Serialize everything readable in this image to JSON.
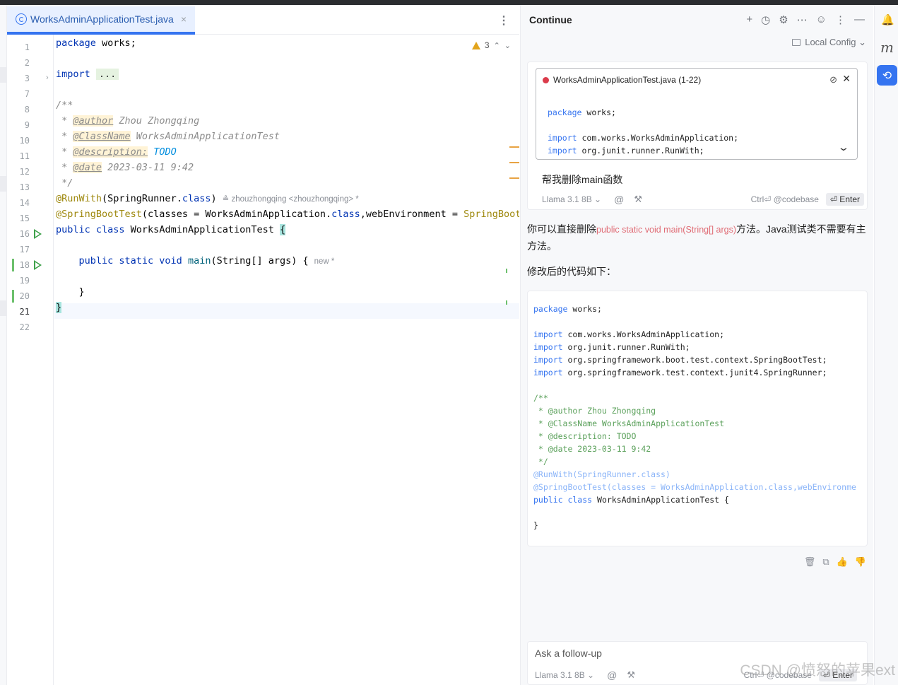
{
  "editor": {
    "tab": {
      "filename": "WorksAdminApplicationTest.java",
      "close": "×"
    },
    "tab_menu": "⋮",
    "warnings": {
      "count": "3",
      "up": "⌃",
      "down": "⌄"
    },
    "line_numbers": [
      "1",
      "2",
      "3",
      "7",
      "8",
      "9",
      "10",
      "11",
      "12",
      "13",
      "14",
      "15",
      "16",
      "17",
      "18",
      "19",
      "20",
      "21",
      "22"
    ],
    "lines": {
      "l1_kw": "package",
      "l1_rest": " works;",
      "l3_kw": "import",
      "l3_fold": "...",
      "l8": "/**",
      "l9_pre": " * ",
      "l9_tag": "@author",
      "l9_rest": " Zhou Zhongqing",
      "l10_pre": " * ",
      "l10_tag": "@ClassName",
      "l10_rest": " WorksAdminApplicationTest",
      "l11_pre": " * ",
      "l11_tag": "@description:",
      "l11_todo": " TODO",
      "l12_pre": " * ",
      "l12_tag": "@date",
      "l12_rest": " 2023-03-11 9:42",
      "l13": " */",
      "l14_ann": "@RunWith",
      "l14_a": "(SpringRunner.",
      "l14_kw": "class",
      "l14_b": ")",
      "l14_inlay": "≗ zhouzhongqing <zhouzhongqing> *",
      "l15_ann": "@SpringBootTest",
      "l15_a": "(classes = WorksAdminApplication.",
      "l15_kw": "class",
      "l15_b": ",webEnvironment = ",
      "l15_c": "SpringBootT",
      "l16_kw": "public class",
      "l16_rest": " WorksAdminApplicationTest ",
      "l16_brace": "{",
      "l18_kw": "    public static void",
      "l18_fn": " main",
      "l18_rest": "(String[] args) {",
      "l18_inlay": "new *",
      "l20": "    }",
      "l21": "}"
    }
  },
  "panel": {
    "title": "Continue",
    "tools": [
      "+",
      "◷",
      "⚙",
      "⋯",
      "☺",
      "⋮",
      "—"
    ],
    "config": "Local Config ⌄",
    "context": {
      "title": "WorksAdminApplicationTest.java (1-22)",
      "lines": [
        {
          "k": "package",
          "t": " works;"
        },
        {
          "k": "",
          "t": ""
        },
        {
          "k": "import",
          "t": " com.works.WorksAdminApplication;"
        },
        {
          "k": "import",
          "t": " org.junit.runner.RunWith;"
        }
      ]
    },
    "user_message": "帮我删除main函数",
    "input_footer": {
      "model": "Llama 3.1 8B ⌄",
      "at": "@",
      "tools": "⚒",
      "shortcut": "Ctrl⏎ @codebase",
      "enter": "⏎ Enter"
    },
    "answer": {
      "pre": "你可以直接删除",
      "code": "public static void main(String[] args)",
      "post": "方法。Java测试类不需要有主方法。"
    },
    "answer2": "修改后的代码如下：",
    "code_block": [
      {
        "k": "package",
        "t": " works;",
        "cls": ""
      },
      {
        "k": "",
        "t": "",
        "cls": ""
      },
      {
        "k": "import",
        "t": " com.works.WorksAdminApplication;",
        "cls": ""
      },
      {
        "k": "import",
        "t": " org.junit.runner.RunWith;",
        "cls": ""
      },
      {
        "k": "import",
        "t": " org.springframework.boot.test.context.SpringBootTest;",
        "cls": ""
      },
      {
        "k": "import",
        "t": " org.springframework.test.context.junit4.SpringRunner;",
        "cls": ""
      },
      {
        "k": "",
        "t": "",
        "cls": ""
      },
      {
        "k": "",
        "t": "/**",
        "cls": "c"
      },
      {
        "k": "",
        "t": " * @author Zhou Zhongqing",
        "cls": "c"
      },
      {
        "k": "",
        "t": " * @ClassName WorksAdminApplicationTest",
        "cls": "c"
      },
      {
        "k": "",
        "t": " * @description: TODO",
        "cls": "c"
      },
      {
        "k": "",
        "t": " * @date 2023-03-11 9:42",
        "cls": "c"
      },
      {
        "k": "",
        "t": " */",
        "cls": "c"
      },
      {
        "k": "",
        "t": "@RunWith(SpringRunner.class)",
        "cls": "a"
      },
      {
        "k": "",
        "t": "@SpringBootTest(classes = WorksAdminApplication.class,webEnvironme",
        "cls": "a"
      },
      {
        "k": "public class",
        "t": " WorksAdminApplicationTest {",
        "cls": ""
      },
      {
        "k": "",
        "t": "",
        "cls": ""
      },
      {
        "k": "",
        "t": "}",
        "cls": ""
      }
    ],
    "msg_actions": [
      "🗑",
      "⧉",
      "👍",
      "👎"
    ],
    "followup": {
      "placeholder": "Ask a follow-up"
    }
  },
  "right_strip": {
    "bell": "🔔",
    "m": "m",
    "continue": "⟲"
  },
  "watermark": "CSDN @愤怒的苹果ext"
}
